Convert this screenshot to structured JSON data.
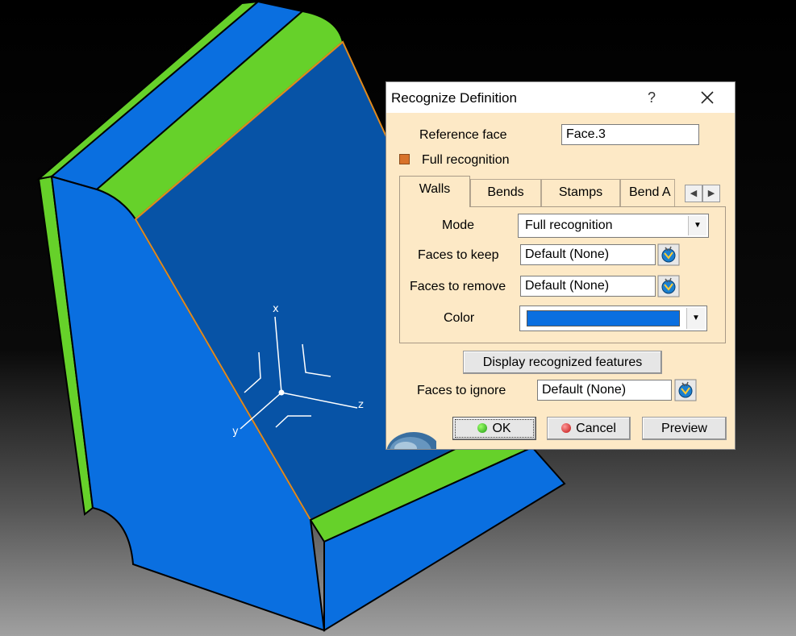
{
  "viewport": {
    "axis_labels": {
      "x": "x",
      "y": "y",
      "z": "z"
    }
  },
  "dialog": {
    "title": "Recognize Definition",
    "help": "?",
    "close": "✕",
    "reference_face_label": "Reference face",
    "reference_face_value": "Face.3",
    "full_recognition_label": "Full recognition",
    "full_recognition_checked": true,
    "tabs": [
      {
        "label": "Walls",
        "active": true
      },
      {
        "label": "Bends",
        "active": false
      },
      {
        "label": "Stamps",
        "active": false
      },
      {
        "label": "Bend A",
        "active": false
      }
    ],
    "walls": {
      "mode_label": "Mode",
      "mode_value": "Full recognition",
      "faces_to_keep_label": "Faces to keep",
      "faces_to_keep_value": "Default (None)",
      "faces_to_remove_label": "Faces to remove",
      "faces_to_remove_value": "Default (None)",
      "color_label": "Color",
      "color_value": "#0a6fe0"
    },
    "display_button": "Display recognized features",
    "faces_to_ignore_label": "Faces to ignore",
    "faces_to_ignore_value": "Default (None)",
    "ok": "OK",
    "cancel": "Cancel",
    "preview": "Preview"
  },
  "colors": {
    "part_blue": "#0a6fe0",
    "part_face": "#0753a6",
    "edge_green": "#66d12a",
    "highlight_orange": "#e08a1e"
  }
}
